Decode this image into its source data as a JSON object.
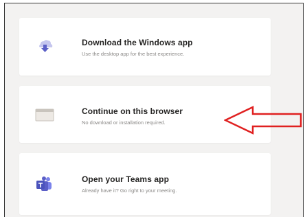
{
  "options": [
    {
      "title": "Download the Windows app",
      "subtitle": "Use the desktop app for the best experience.",
      "icon": "download-icon"
    },
    {
      "title": "Continue on this browser",
      "subtitle": "No download or installation required.",
      "icon": "browser-window-icon"
    },
    {
      "title": "Open your Teams app",
      "subtitle": "Already have it? Go right to your meeting.",
      "icon": "teams-logo-icon"
    }
  ],
  "annotation": {
    "icon": "left-arrow-annotation",
    "color": "#e02020"
  },
  "colors": {
    "accent": "#5b5fc7",
    "page_background": "#f3f2f1"
  }
}
